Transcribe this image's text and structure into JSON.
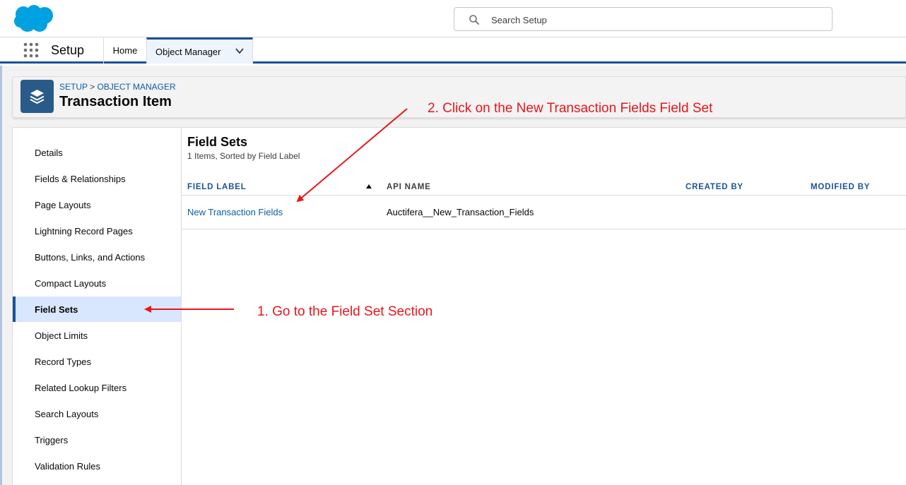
{
  "header": {
    "search_placeholder": "Search Setup"
  },
  "nav": {
    "app_name": "Setup",
    "home_label": "Home",
    "object_manager_label": "Object Manager"
  },
  "object": {
    "breadcrumb_setup": "SETUP",
    "breadcrumb_sep": ">",
    "breadcrumb_object_manager": "OBJECT MANAGER",
    "title": "Transaction Item"
  },
  "sidebar": {
    "items": [
      {
        "label": "Details"
      },
      {
        "label": "Fields & Relationships"
      },
      {
        "label": "Page Layouts"
      },
      {
        "label": "Lightning Record Pages"
      },
      {
        "label": "Buttons, Links, and Actions"
      },
      {
        "label": "Compact Layouts"
      },
      {
        "label": "Field Sets"
      },
      {
        "label": "Object Limits"
      },
      {
        "label": "Record Types"
      },
      {
        "label": "Related Lookup Filters"
      },
      {
        "label": "Search Layouts"
      },
      {
        "label": "Triggers"
      },
      {
        "label": "Validation Rules"
      }
    ],
    "active_index": 6
  },
  "main": {
    "title": "Field Sets",
    "subtitle": "1 Items, Sorted by Field Label",
    "columns": [
      "FIELD LABEL",
      "API NAME",
      "CREATED BY",
      "MODIFIED BY"
    ],
    "rows": [
      {
        "field_label": "New Transaction Fields",
        "api_name": "Auctifera__New_Transaction_Fields",
        "created_by": "",
        "modified_by": ""
      }
    ]
  },
  "annotations": {
    "step1": "1. Go to the Field Set Section",
    "step2": "2. Click on the New Transaction Fields Field Set",
    "color": "#e8151b"
  },
  "colors": {
    "brand_blue": "#1b5297",
    "link_blue": "#0b5cab",
    "active_bg": "#d8e6fe",
    "cloud_blue": "#00a1e0"
  }
}
